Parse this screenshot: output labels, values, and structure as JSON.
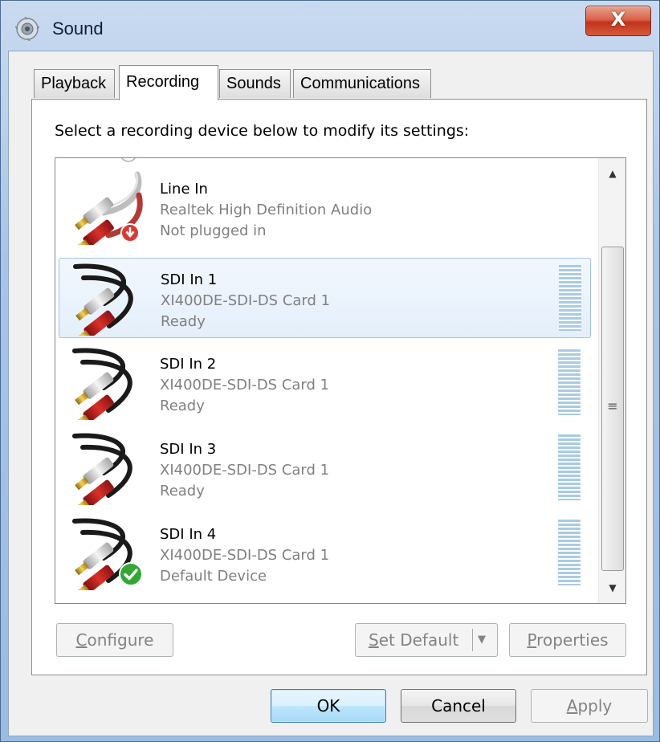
{
  "window": {
    "title": "Sound",
    "close_glyph": "X"
  },
  "tabs": [
    {
      "label": "Playback",
      "active": false
    },
    {
      "label": "Recording",
      "active": true
    },
    {
      "label": "Sounds",
      "active": false
    },
    {
      "label": "Communications",
      "active": false
    }
  ],
  "instruction": "Select a recording device below to modify its settings:",
  "devices": [
    {
      "name": "Line In",
      "description": "Realtek High Definition Audio",
      "status": "Not plugged in",
      "badge": "unplugged-icon",
      "selected": false
    },
    {
      "name": "SDI In 1",
      "description": "XI400DE-SDI-DS Card 1",
      "status": "Ready",
      "badge": "",
      "selected": true
    },
    {
      "name": "SDI In 2",
      "description": "XI400DE-SDI-DS Card 1",
      "status": "Ready",
      "badge": "",
      "selected": false
    },
    {
      "name": "SDI In 3",
      "description": "XI400DE-SDI-DS Card 1",
      "status": "Ready",
      "badge": "",
      "selected": false
    },
    {
      "name": "SDI In 4",
      "description": "XI400DE-SDI-DS Card 1",
      "status": "Default Device",
      "badge": "default-check-icon",
      "selected": false
    }
  ],
  "buttons": {
    "configure": {
      "label_accel": "C",
      "label_rest": "onfigure",
      "enabled": false
    },
    "set_default": {
      "label_accel": "S",
      "label_rest": "et Default",
      "enabled": false
    },
    "properties": {
      "label_accel": "P",
      "label_rest": "roperties",
      "enabled": false
    },
    "ok": {
      "label": "OK"
    },
    "cancel": {
      "label": "Cancel"
    },
    "apply": {
      "label_accel": "A",
      "label_rest": "pply",
      "enabled": false
    }
  },
  "scrollbar": {
    "up_glyph": "▲",
    "down_glyph": "▼",
    "grip_glyph": "≡"
  },
  "colors": {
    "selected_row": "#e4effb",
    "meter": "#a9cbe3",
    "unplugged": "#c0392b",
    "default_check": "#2e9e2e"
  }
}
